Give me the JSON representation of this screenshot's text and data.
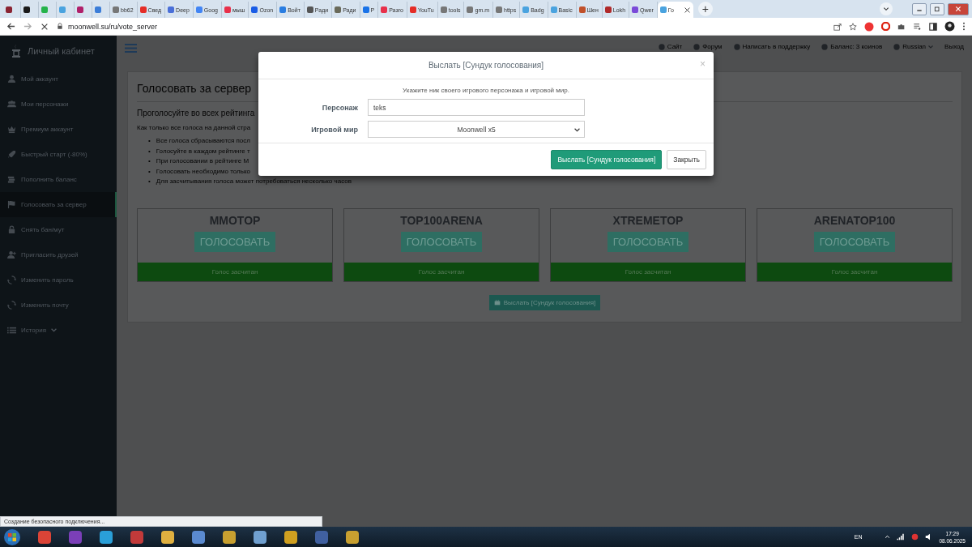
{
  "browser": {
    "tabs": [
      {
        "color": "#8a2432",
        "selected": false
      },
      {
        "color": "#1a1a1a",
        "selected": false
      },
      {
        "color": "#25b34b",
        "selected": false
      },
      {
        "color": "#4aa3df",
        "selected": false
      },
      {
        "color": "#b0206a",
        "selected": false
      },
      {
        "color": "#3b7dd8",
        "selected": false
      },
      {
        "title": "bb62",
        "color": "#777777",
        "selected": false
      },
      {
        "title": "Свед",
        "color": "#e52d27",
        "selected": false
      },
      {
        "title": "Deep",
        "color": "#4a6fd8",
        "selected": false
      },
      {
        "title": "Goog",
        "color": "#4285f4",
        "selected": false
      },
      {
        "title": "мыш",
        "color": "#e8304a",
        "selected": false
      },
      {
        "title": "Ozon",
        "color": "#1a5ce6",
        "selected": false
      },
      {
        "title": "Войт",
        "color": "#2a7de1",
        "selected": false
      },
      {
        "title": "Ради",
        "color": "#555555",
        "selected": false
      },
      {
        "title": "Ради",
        "color": "#6a6a5a",
        "selected": false
      },
      {
        "title": "Р",
        "color": "#1a73e8",
        "selected": false
      },
      {
        "title": "Разго",
        "color": "#e8304a",
        "selected": false
      },
      {
        "title": "YouTu",
        "color": "#e52d27",
        "selected": false
      },
      {
        "title": "tools",
        "color": "#777777",
        "selected": false
      },
      {
        "title": "gm.m",
        "color": "#777777",
        "selected": false
      },
      {
        "title": "https",
        "color": "#777777",
        "selected": false
      },
      {
        "title": "Badg",
        "color": "#4aa3df",
        "selected": false
      },
      {
        "title": "Basic",
        "color": "#4aa3df",
        "selected": false
      },
      {
        "title": "Шен",
        "color": "#c0502a",
        "selected": false
      },
      {
        "title": "Lokh",
        "color": "#b02a2a",
        "selected": false
      },
      {
        "title": "Qwer",
        "color": "#7a4ad8",
        "selected": false
      },
      {
        "title": "Го",
        "color": "#4aa3df",
        "selected": true
      }
    ],
    "new_tab": "+",
    "address": "moonwell.su/ru/vote_server"
  },
  "sidebar": {
    "title": "Личный кабинет",
    "items": [
      {
        "label": "Мой аккаунт",
        "selected": false
      },
      {
        "label": "Мои персонажи",
        "selected": false
      },
      {
        "label": "Премиум аккаунт",
        "selected": false
      },
      {
        "label": "Быстрый старт (-80%)",
        "selected": false
      },
      {
        "label": "Пополнить баланс",
        "selected": false
      },
      {
        "label": "Голосовать за сервер",
        "selected": true
      },
      {
        "label": "Снять бан/мут",
        "selected": false
      },
      {
        "label": "Пригласить друзей",
        "selected": false
      },
      {
        "label": "Изменить пароль",
        "selected": false
      },
      {
        "label": "Изменить почту",
        "selected": false
      },
      {
        "label": "История",
        "selected": false
      }
    ]
  },
  "top_nav": [
    {
      "label": "Сайт"
    },
    {
      "label": "Форум"
    },
    {
      "label": "Написать в поддержку"
    },
    {
      "label": "Баланс: 3 коинов"
    },
    {
      "label": "Russian"
    },
    {
      "label": "Выход"
    }
  ],
  "content": {
    "title": "Голосовать за сервер",
    "subtitle": "Проголосуйте во всех рейтинга",
    "intro": "Как только все голоса на данной стра",
    "bullets": [
      {
        "marker": "•",
        "text": "Все голоса сбрасываются посл"
      },
      {
        "marker": "•",
        "text": "Голосуйте в каждом рейтинге т"
      },
      {
        "marker": "•",
        "text": "При голосовании в рейтинге М"
      },
      {
        "marker": "•",
        "text": "Голосовать необходимо только"
      },
      {
        "marker": "•",
        "text": "Для засчитывания голоса может потребоваться несколько часов"
      }
    ],
    "cards": [
      {
        "name": "MMOTOP",
        "button": "ГОЛОСОВАТЬ",
        "status": "Голос засчитан"
      },
      {
        "name": "TOP100ARENA",
        "button": "ГОЛОСОВАТЬ",
        "status": "Голос засчитан"
      },
      {
        "name": "XTREMETOP",
        "button": "ГОЛОСОВАТЬ",
        "status": "Голос засчитан"
      },
      {
        "name": "ARENATOP100",
        "button": "ГОЛОСОВАТЬ",
        "status": "Голос засчитан"
      }
    ],
    "send_button": "Выслать [Сундук голосования]"
  },
  "modal": {
    "title": "Выслать [Сундук голосования]",
    "close": "×",
    "hint": "Укажите ник своего игрового персонажа и игровой мир.",
    "fields": [
      {
        "label": "Персонаж",
        "kind": "input",
        "value": "teks"
      },
      {
        "label": "Игровой мир",
        "kind": "select",
        "value": "Moonwell x5"
      }
    ],
    "buttons": [
      {
        "label": "Выслать [Сундук голосования]",
        "kind": "primary"
      },
      {
        "label": "Закрыть",
        "kind": "default"
      }
    ]
  },
  "status_bubble": "Создание безопасного подключения...",
  "taskbar": {
    "language": "EN",
    "time": "17:29",
    "date": "08.06.2025"
  }
}
